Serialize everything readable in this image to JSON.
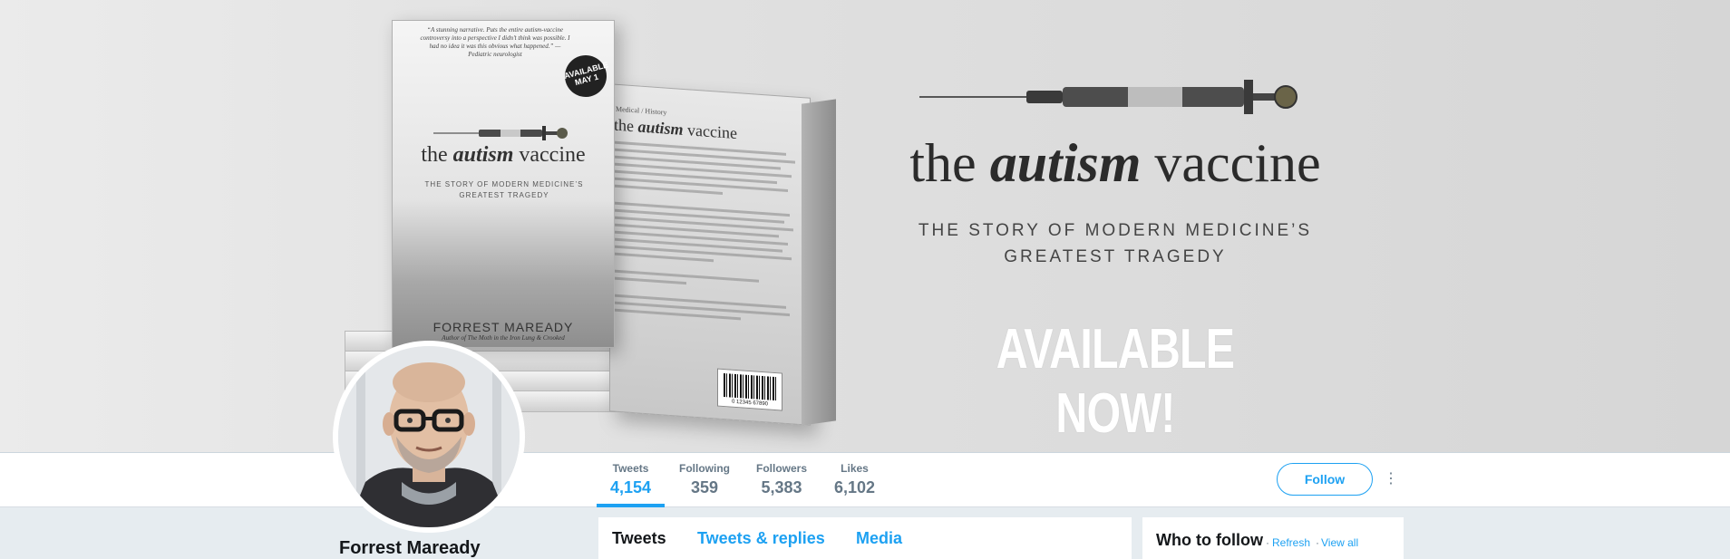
{
  "banner": {
    "front_cover": {
      "quote": "“A stunning narrative. Puts the entire autism-vaccine controversy into a perspective I didn’t think was possible. I had no idea it was this obvious what happened.” —Pediatric neurologist",
      "badge": "AVAILABLE MAY 1",
      "title_prefix": "the",
      "title_emphasis": "autism",
      "title_suffix": "vaccine",
      "subtitle": "THE STORY OF MODERN MEDICINE’S GREATEST TRAGEDY",
      "author": "FORREST MAREADY",
      "author_sub": "Author of The Moth in the Iron Lung & Crooked"
    },
    "back_cover": {
      "category": "Medical / History",
      "title_prefix": "the",
      "title_emphasis": "autism",
      "title_suffix": "vaccine",
      "barcode_number": "0 12345 67890"
    },
    "headline": {
      "title_prefix": "the",
      "title_emphasis": "autism",
      "title_suffix": "vaccine",
      "subtitle_line1": "THE STORY OF MODERN MEDICINE’S",
      "subtitle_line2": "GREATEST TRAGEDY",
      "cta": "AVAILABLE NOW!"
    }
  },
  "profile": {
    "name": "Forrest Maready"
  },
  "stats": [
    {
      "label": "Tweets",
      "value": "4,154"
    },
    {
      "label": "Following",
      "value": "359"
    },
    {
      "label": "Followers",
      "value": "5,383"
    },
    {
      "label": "Likes",
      "value": "6,102"
    }
  ],
  "actions": {
    "follow_label": "Follow",
    "more_label": "⋮"
  },
  "tabs": [
    {
      "label": "Tweets"
    },
    {
      "label": "Tweets & replies"
    },
    {
      "label": "Media"
    }
  ],
  "who_to_follow": {
    "title": "Who to follow",
    "separator": "·",
    "refresh": "Refresh",
    "view_all": "View all"
  },
  "colors": {
    "accent": "#1da1f2",
    "muted": "#657786",
    "text": "#14171a",
    "background": "#e6ecf0"
  }
}
